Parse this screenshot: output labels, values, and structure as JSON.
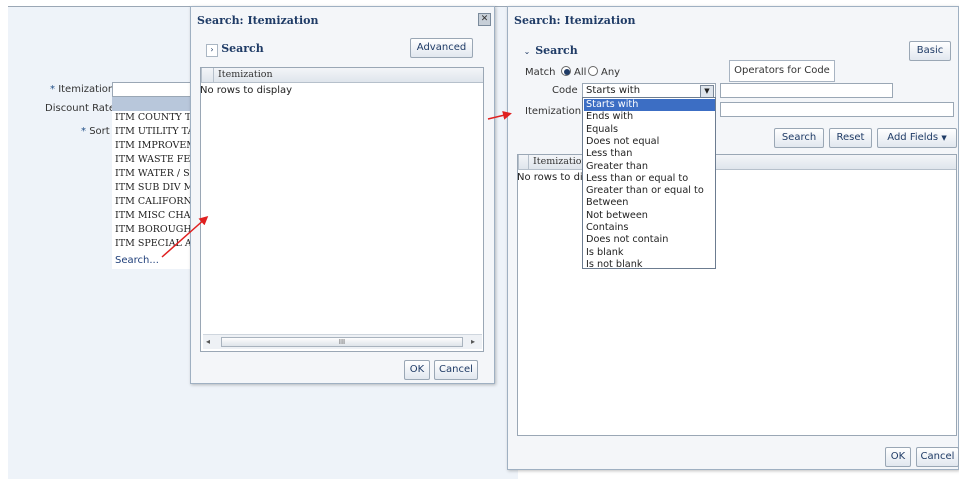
{
  "form": {
    "itemization_label": "Itemization",
    "discount_rate_label": "Discount Rate",
    "sort_label": "Sort",
    "required_mark": "*"
  },
  "dropdown": {
    "items": [
      "ITM COUNTY TAX",
      "ITM UTILITY TAX",
      "ITM IMPROVEMENT",
      "ITM WASTE FEE",
      "ITM WATER / SEW",
      "ITM SUB DIV MAI",
      "ITM CALIFORNIA",
      "ITM MISC CHARG",
      "ITM BOROUGH T",
      "ITM SPECIAL ASS"
    ],
    "search_link": "Search..."
  },
  "dialog1": {
    "title": "Search: Itemization",
    "section": "Search",
    "advanced_button": "Advanced",
    "column_header": "Itemization",
    "no_rows": "No rows to display",
    "scroll_thumb": "III",
    "ok": "OK",
    "cancel": "Cancel"
  },
  "dialog2": {
    "title": "Search: Itemization",
    "section": "Search",
    "basic_button": "Basic",
    "match_label": "Match",
    "match_all": "All",
    "match_any": "Any",
    "code_label": "Code",
    "code_value": "Starts with",
    "itemization_label": "Itemization",
    "tooltip": "Operators for Code",
    "search_button": "Search",
    "reset_button": "Reset",
    "add_fields_button": "Add Fields",
    "column_header": "Itemization",
    "no_rows": "No rows to disp",
    "ok": "OK",
    "cancel": "Cancel",
    "operators": [
      "Starts with",
      "Ends with",
      "Equals",
      "Does not equal",
      "Less than",
      "Greater than",
      "Less than or equal to",
      "Greater than or equal to",
      "Between",
      "Not between",
      "Contains",
      "Does not contain",
      "Is blank",
      "Is not blank"
    ]
  },
  "icons": {
    "close": "close-icon",
    "disclosure": "disclosure-icon",
    "dropdown_arrow": "dropdown-arrow-icon",
    "arrow": "red-arrow-icon"
  },
  "colors": {
    "title_text": "#1f3b66",
    "selected_option": "#3c6ec4",
    "arrow": "#e02020"
  }
}
